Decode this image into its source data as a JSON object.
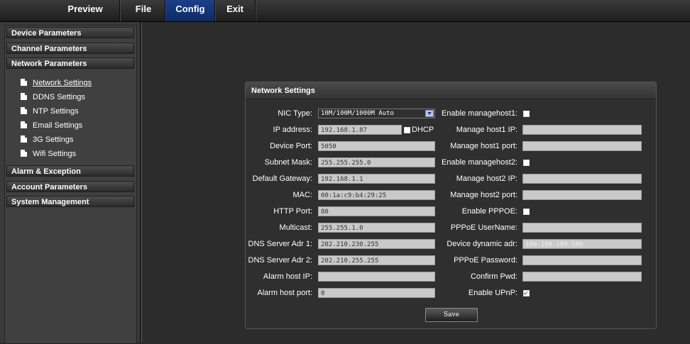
{
  "topmenu": {
    "preview": "Preview",
    "file": "File",
    "config": "Config",
    "exit": "Exit"
  },
  "sidebar": {
    "device": "Device Parameters",
    "channel": "Channel Parameters",
    "network": "Network Parameters",
    "sub": [
      "Network Settings",
      "DDNS Settings",
      "NTP Settings",
      "Email Settings",
      "3G Settings",
      "Wifi Settings"
    ],
    "alarm": "Alarm & Exception",
    "account": "Account Parameters",
    "system": "System Management"
  },
  "panel": {
    "title": "Network Settings",
    "left": {
      "nic_type_label": "NIC Type:",
      "nic_type_value": "10M/100M/1000M Auto",
      "ip_label": "IP address:",
      "ip_value": "192.168.1.87",
      "dhcp_label": "DHCP",
      "port_label": "Device Port:",
      "port_value": "5050",
      "subnet_label": "Subnet Mask:",
      "subnet_value": "255.255.255.0",
      "gateway_label": "Default Gateway:",
      "gateway_value": "192.168.1.1",
      "mac_label": "MAC:",
      "mac_value": "00:1a:c9:b4:29:25",
      "http_label": "HTTP Port:",
      "http_value": "80",
      "multicast_label": "Multicast:",
      "multicast_value": "255.255.1.0",
      "dns1_label": "DNS Server Adr 1:",
      "dns1_value": "202.210.230.255",
      "dns2_label": "DNS Server Adr 2:",
      "dns2_value": "202.210.255.255",
      "alarm_ip_label": "Alarm host IP:",
      "alarm_ip_value": "",
      "alarm_port_label": "Alarm host port:",
      "alarm_port_value": "0"
    },
    "right": {
      "enable_mh1_label": "Enable managehost1:",
      "mh1_ip_label": "Manage host1 IP:",
      "mh1_port_label": "Manage host1 port:",
      "enable_mh2_label": "Enable managehost2:",
      "mh2_ip_label": "Manage host2 IP:",
      "mh2_port_label": "Manage host2 port:",
      "enable_pppoe_label": "Enable PPPOE:",
      "pppoe_user_label": "PPPoE UserName:",
      "dyn_adr_label": "Device dynamic adr:",
      "dyn_adr_value": "100.100.100.100",
      "pppoe_pwd_label": "PPPoE Password:",
      "confirm_pwd_label": "Confirm Pwd:",
      "enable_upnp_label": "Enable UPnP:"
    },
    "save_label": "Save"
  },
  "colors": {
    "active_tab": "#1b3f8a",
    "background": "#2a2a2a",
    "input_bg": "#c9c9c9"
  }
}
